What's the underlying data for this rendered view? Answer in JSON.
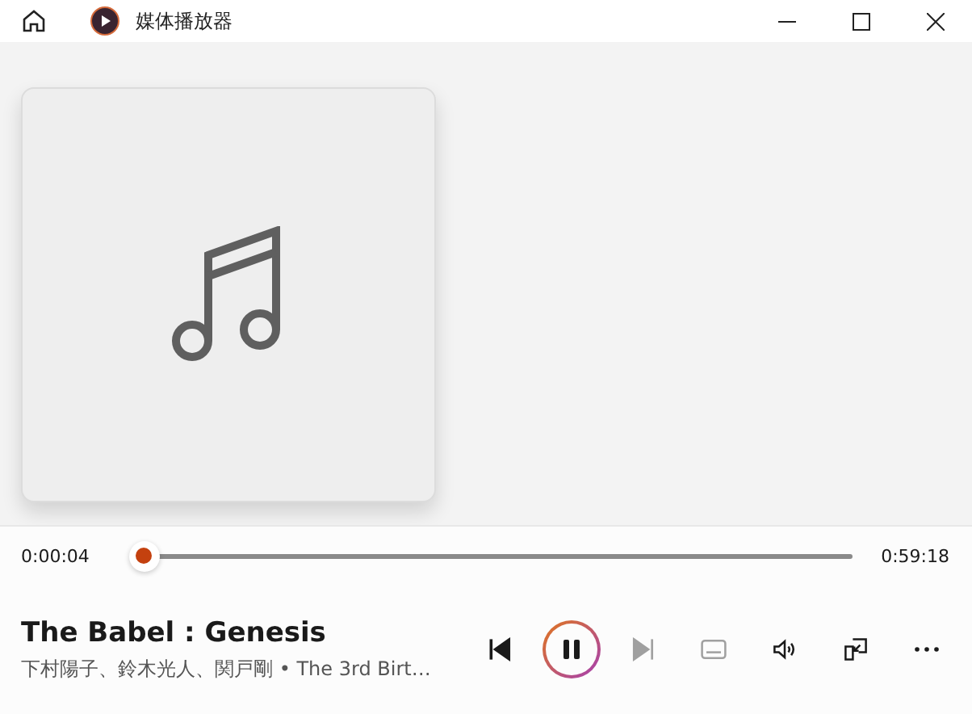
{
  "window": {
    "title": "媒体播放器"
  },
  "progress": {
    "elapsed": "0:00:04",
    "total": "0:59:18",
    "level": 0.002
  },
  "track": {
    "title": "The Babel : Genesis",
    "subtitle": "下村陽子、鈴木光人、関戸剛 • The 3rd Birt…"
  },
  "controls": [
    {
      "kind": "previous",
      "disabled": false
    },
    {
      "kind": "pause",
      "disabled": false
    },
    {
      "kind": "next",
      "disabled": true
    },
    {
      "kind": "captions",
      "disabled": true
    },
    {
      "kind": "volume",
      "disabled": false
    },
    {
      "kind": "miniplayer",
      "disabled": false
    },
    {
      "kind": "more",
      "disabled": false
    }
  ]
}
